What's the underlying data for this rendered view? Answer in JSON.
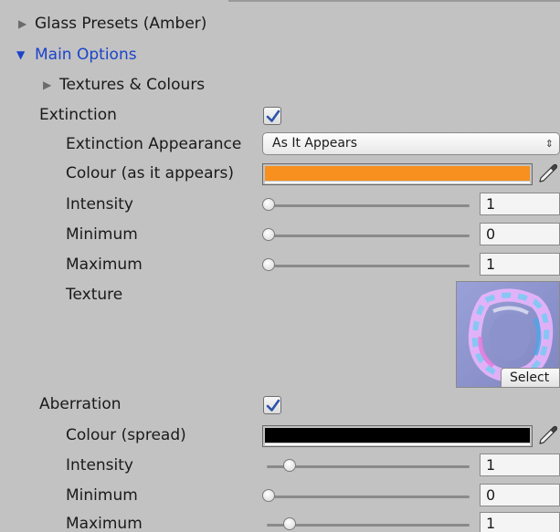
{
  "foldouts": {
    "glass_presets": "Glass Presets (Amber)",
    "main_options": "Main Options",
    "textures_colours": "Textures & Colours"
  },
  "extinction": {
    "label": "Extinction",
    "checked": true,
    "appearance_label": "Extinction Appearance",
    "appearance_value": "As It Appears",
    "colour_label": "Colour (as it appears)",
    "colour_value": "#f7901e",
    "intensity_label": "Intensity",
    "intensity_value": "1",
    "minimum_label": "Minimum",
    "minimum_value": "0",
    "maximum_label": "Maximum",
    "maximum_value": "1",
    "texture_label": "Texture",
    "texture_select": "Select"
  },
  "aberration": {
    "label": "Aberration",
    "checked": true,
    "colour_label": "Colour (spread)",
    "colour_value": "#000000",
    "intensity_label": "Intensity",
    "intensity_value": "1",
    "minimum_label": "Minimum",
    "minimum_value": "0",
    "maximum_label": "Maximum",
    "maximum_value": "1"
  },
  "icons": {
    "foldout_collapsed": "triangle-right-icon",
    "foldout_expanded": "triangle-down-icon",
    "checkmark": "checkmark-icon",
    "eyedropper": "eyedropper-icon",
    "dropdown_arrows": "updown-arrows-icon"
  },
  "colors": {
    "panel_bg": "#c2c2c2",
    "accent_blue": "#1b44c9"
  }
}
